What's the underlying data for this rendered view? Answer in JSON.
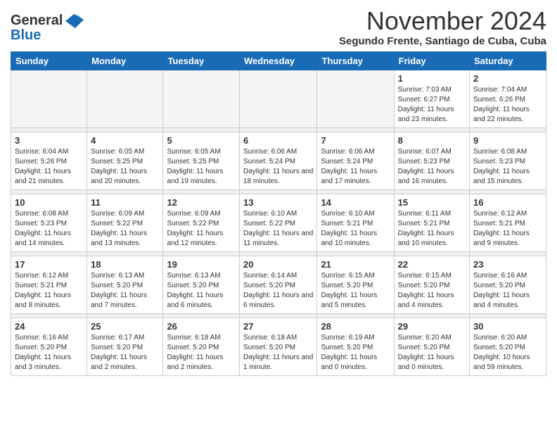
{
  "logo": {
    "general": "General",
    "blue": "Blue"
  },
  "title": "November 2024",
  "subtitle": "Segundo Frente, Santiago de Cuba, Cuba",
  "days_of_week": [
    "Sunday",
    "Monday",
    "Tuesday",
    "Wednesday",
    "Thursday",
    "Friday",
    "Saturday"
  ],
  "weeks": [
    [
      {
        "day": "",
        "info": ""
      },
      {
        "day": "",
        "info": ""
      },
      {
        "day": "",
        "info": ""
      },
      {
        "day": "",
        "info": ""
      },
      {
        "day": "",
        "info": ""
      },
      {
        "day": "1",
        "info": "Sunrise: 7:03 AM\nSunset: 6:27 PM\nDaylight: 11 hours and 23 minutes."
      },
      {
        "day": "2",
        "info": "Sunrise: 7:04 AM\nSunset: 6:26 PM\nDaylight: 11 hours and 22 minutes."
      }
    ],
    [
      {
        "day": "3",
        "info": "Sunrise: 6:04 AM\nSunset: 5:26 PM\nDaylight: 11 hours and 21 minutes."
      },
      {
        "day": "4",
        "info": "Sunrise: 6:05 AM\nSunset: 5:25 PM\nDaylight: 11 hours and 20 minutes."
      },
      {
        "day": "5",
        "info": "Sunrise: 6:05 AM\nSunset: 5:25 PM\nDaylight: 11 hours and 19 minutes."
      },
      {
        "day": "6",
        "info": "Sunrise: 6:06 AM\nSunset: 5:24 PM\nDaylight: 11 hours and 18 minutes."
      },
      {
        "day": "7",
        "info": "Sunrise: 6:06 AM\nSunset: 5:24 PM\nDaylight: 11 hours and 17 minutes."
      },
      {
        "day": "8",
        "info": "Sunrise: 6:07 AM\nSunset: 5:23 PM\nDaylight: 11 hours and 16 minutes."
      },
      {
        "day": "9",
        "info": "Sunrise: 6:08 AM\nSunset: 5:23 PM\nDaylight: 11 hours and 15 minutes."
      }
    ],
    [
      {
        "day": "10",
        "info": "Sunrise: 6:08 AM\nSunset: 5:23 PM\nDaylight: 11 hours and 14 minutes."
      },
      {
        "day": "11",
        "info": "Sunrise: 6:09 AM\nSunset: 5:22 PM\nDaylight: 11 hours and 13 minutes."
      },
      {
        "day": "12",
        "info": "Sunrise: 6:09 AM\nSunset: 5:22 PM\nDaylight: 11 hours and 12 minutes."
      },
      {
        "day": "13",
        "info": "Sunrise: 6:10 AM\nSunset: 5:22 PM\nDaylight: 11 hours and 11 minutes."
      },
      {
        "day": "14",
        "info": "Sunrise: 6:10 AM\nSunset: 5:21 PM\nDaylight: 11 hours and 10 minutes."
      },
      {
        "day": "15",
        "info": "Sunrise: 6:11 AM\nSunset: 5:21 PM\nDaylight: 11 hours and 10 minutes."
      },
      {
        "day": "16",
        "info": "Sunrise: 6:12 AM\nSunset: 5:21 PM\nDaylight: 11 hours and 9 minutes."
      }
    ],
    [
      {
        "day": "17",
        "info": "Sunrise: 6:12 AM\nSunset: 5:21 PM\nDaylight: 11 hours and 8 minutes."
      },
      {
        "day": "18",
        "info": "Sunrise: 6:13 AM\nSunset: 5:20 PM\nDaylight: 11 hours and 7 minutes."
      },
      {
        "day": "19",
        "info": "Sunrise: 6:13 AM\nSunset: 5:20 PM\nDaylight: 11 hours and 6 minutes."
      },
      {
        "day": "20",
        "info": "Sunrise: 6:14 AM\nSunset: 5:20 PM\nDaylight: 11 hours and 6 minutes."
      },
      {
        "day": "21",
        "info": "Sunrise: 6:15 AM\nSunset: 5:20 PM\nDaylight: 11 hours and 5 minutes."
      },
      {
        "day": "22",
        "info": "Sunrise: 6:15 AM\nSunset: 5:20 PM\nDaylight: 11 hours and 4 minutes."
      },
      {
        "day": "23",
        "info": "Sunrise: 6:16 AM\nSunset: 5:20 PM\nDaylight: 11 hours and 4 minutes."
      }
    ],
    [
      {
        "day": "24",
        "info": "Sunrise: 6:16 AM\nSunset: 5:20 PM\nDaylight: 11 hours and 3 minutes."
      },
      {
        "day": "25",
        "info": "Sunrise: 6:17 AM\nSunset: 5:20 PM\nDaylight: 11 hours and 2 minutes."
      },
      {
        "day": "26",
        "info": "Sunrise: 6:18 AM\nSunset: 5:20 PM\nDaylight: 11 hours and 2 minutes."
      },
      {
        "day": "27",
        "info": "Sunrise: 6:18 AM\nSunset: 5:20 PM\nDaylight: 11 hours and 1 minute."
      },
      {
        "day": "28",
        "info": "Sunrise: 6:19 AM\nSunset: 5:20 PM\nDaylight: 11 hours and 0 minutes."
      },
      {
        "day": "29",
        "info": "Sunrise: 6:20 AM\nSunset: 5:20 PM\nDaylight: 11 hours and 0 minutes."
      },
      {
        "day": "30",
        "info": "Sunrise: 6:20 AM\nSunset: 5:20 PM\nDaylight: 10 hours and 59 minutes."
      }
    ]
  ]
}
